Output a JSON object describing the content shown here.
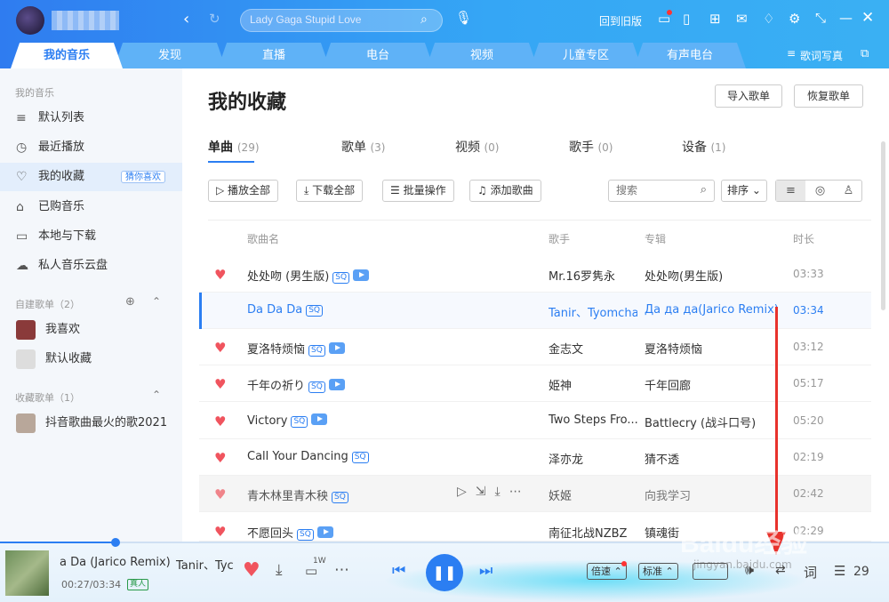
{
  "header": {
    "search_placeholder": "Lady Gaga Stupid Love",
    "back_old": "回到旧版",
    "icons": [
      "back-icon",
      "refresh-icon",
      "search-icon",
      "mic-icon",
      "message-icon",
      "phone-icon",
      "apps-icon",
      "mail-icon",
      "skin-icon",
      "settings-icon",
      "mini-mode-icon",
      "minimize-icon",
      "close-icon"
    ]
  },
  "tabs": [
    "我的音乐",
    "发现",
    "直播",
    "电台",
    "视频",
    "儿童专区",
    "有声电台"
  ],
  "lyric_label": "歌词写真",
  "sidebar": {
    "section1": "我的音乐",
    "items": [
      {
        "label": "默认列表",
        "icon": "playlist-icon"
      },
      {
        "label": "最近播放",
        "icon": "clock-icon"
      },
      {
        "label": "我的收藏",
        "icon": "heart-outline-icon",
        "badge": "猜你喜欢"
      },
      {
        "label": "已购音乐",
        "icon": "bag-icon"
      },
      {
        "label": "本地与下载",
        "icon": "monitor-icon"
      },
      {
        "label": "私人音乐云盘",
        "icon": "cloud-icon"
      }
    ],
    "section2": "自建歌单（2）",
    "created": [
      {
        "label": "我喜欢"
      },
      {
        "label": "默认收藏"
      }
    ],
    "section3": "收藏歌单（1）",
    "collected": [
      {
        "label": "抖音歌曲最火的歌2021"
      }
    ]
  },
  "main": {
    "title": "我的收藏",
    "import_btn": "导入歌单",
    "restore_btn": "恢复歌单",
    "subtabs": [
      {
        "label": "单曲",
        "count": "(29)"
      },
      {
        "label": "歌单",
        "count": "(3)"
      },
      {
        "label": "视频",
        "count": "(0)"
      },
      {
        "label": "歌手",
        "count": "(0)"
      },
      {
        "label": "设备",
        "count": "(1)"
      }
    ],
    "toolbar": {
      "play_all": "播放全部",
      "download_all": "下载全部",
      "batch": "批量操作",
      "add_song": "添加歌曲",
      "search_placeholder": "搜索",
      "sort": "排序"
    },
    "headers": {
      "name": "歌曲名",
      "singer": "歌手",
      "album": "专辑",
      "duration": "时长"
    },
    "songs": [
      {
        "name": "处处吻 (男生版)",
        "sq": "SQ",
        "mv": true,
        "singer": "Mr.16罗隽永",
        "album": "处处吻(男生版)",
        "duration": "03:33"
      },
      {
        "name": "Da Da Da",
        "sq": "SQ",
        "mv": false,
        "singer": "Tanir、Tyomcha",
        "album": "Да да да(Jarico Remix)",
        "duration": "03:34"
      },
      {
        "name": "夏洛特烦恼",
        "sq": "SQ",
        "mv": true,
        "singer": "金志文",
        "album": "夏洛特烦恼",
        "duration": "03:12"
      },
      {
        "name": "千年の祈り",
        "sq": "SQ",
        "mv": true,
        "singer": "姫神",
        "album": "千年回廊",
        "duration": "05:17"
      },
      {
        "name": "Victory",
        "sq": "SQ",
        "mv": true,
        "singer": "Two Steps Fro...",
        "album": "Battlecry (战斗口号)",
        "duration": "05:20"
      },
      {
        "name": "Call Your Dancing",
        "sq": "SQ",
        "mv": false,
        "singer": "泽亦龙",
        "album": "猜不透",
        "duration": "02:19"
      },
      {
        "name": "青木林里青木秧",
        "sq": "SQ",
        "mv": false,
        "singer": "妖姬",
        "album": "向我学习",
        "duration": "02:42"
      },
      {
        "name": "不愿回头",
        "sq": "SQ",
        "mv": true,
        "singer": "南征北战NZBZ",
        "album": "镇魂街",
        "duration": "02:29"
      }
    ]
  },
  "player": {
    "song": "a Da (Jarico Remix)",
    "artist": "Tanir、Tyc",
    "time": "00:27/03:34",
    "tag": "真人",
    "comment_count": "1W",
    "speed": "倍速",
    "quality": "标准",
    "lyric_btn": "词",
    "queue_count": "29",
    "progress": 0.13
  },
  "watermark": "Baidu经验",
  "watermark_url": "jingyan.baidu.com"
}
